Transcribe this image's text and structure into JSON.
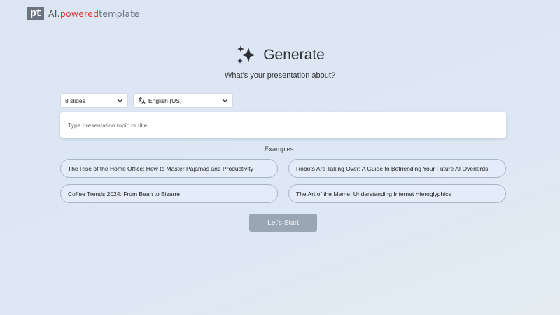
{
  "logo": {
    "mark": "pt",
    "part1": "AI.",
    "part2": "powered",
    "part3": "template"
  },
  "header": {
    "title": "Generate",
    "subtitle": "What's your presentation about?"
  },
  "controls": {
    "slides": {
      "value": "8 slides"
    },
    "language": {
      "value": "English (US)"
    },
    "topic": {
      "placeholder": "Type presentation topic or title"
    }
  },
  "examples": {
    "label": "Examples:",
    "items": [
      "The Rise of the Home Office: How to Master Pajamas and Productivity",
      "Robots Are Taking Over: A Guide to Befriending Your Future AI Overlords",
      "Coffee Trends 2024: From Bean to Bizarre",
      "The Art of the Meme: Understanding Internet Hieroglyphics"
    ]
  },
  "actions": {
    "start_label": "Let's Start"
  },
  "icons": {
    "sparkle": "sparkle-icon",
    "translate": "translate-icon",
    "chevron": "chevron-down-icon"
  },
  "colors": {
    "brand_red": "#e03a3a",
    "brand_gray": "#6b7480",
    "button_disabled": "#9aa6b3"
  }
}
